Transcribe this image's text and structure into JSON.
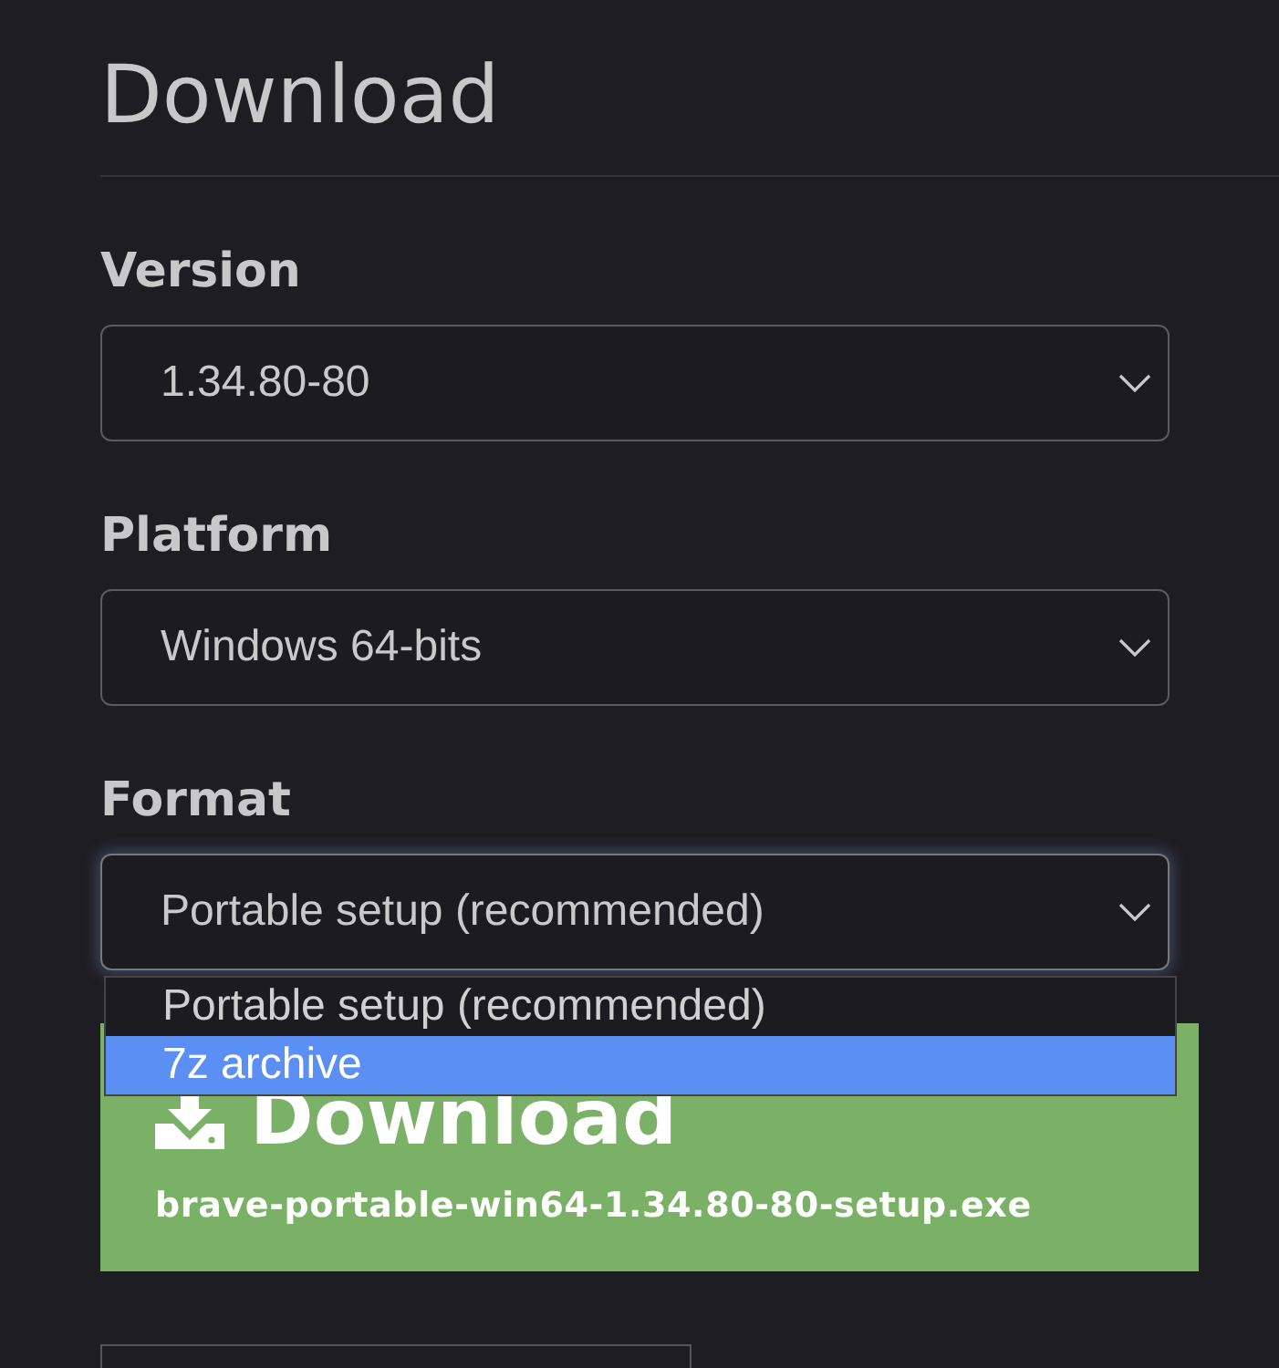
{
  "heading": "Download",
  "fields": [
    {
      "label": "Version",
      "value": "1.34.80-80",
      "expanded": false
    },
    {
      "label": "Platform",
      "value": "Windows 64-bits",
      "expanded": false
    },
    {
      "label": "Format",
      "value": "Portable setup (recommended)",
      "expanded": true,
      "options": [
        {
          "label": "Portable setup (recommended)",
          "highlighted": false
        },
        {
          "label": "7z archive",
          "highlighted": true
        }
      ]
    }
  ],
  "download_button": {
    "title": "Download",
    "filename": "brave-portable-win64-1.34.80-80-setup.exe"
  }
}
